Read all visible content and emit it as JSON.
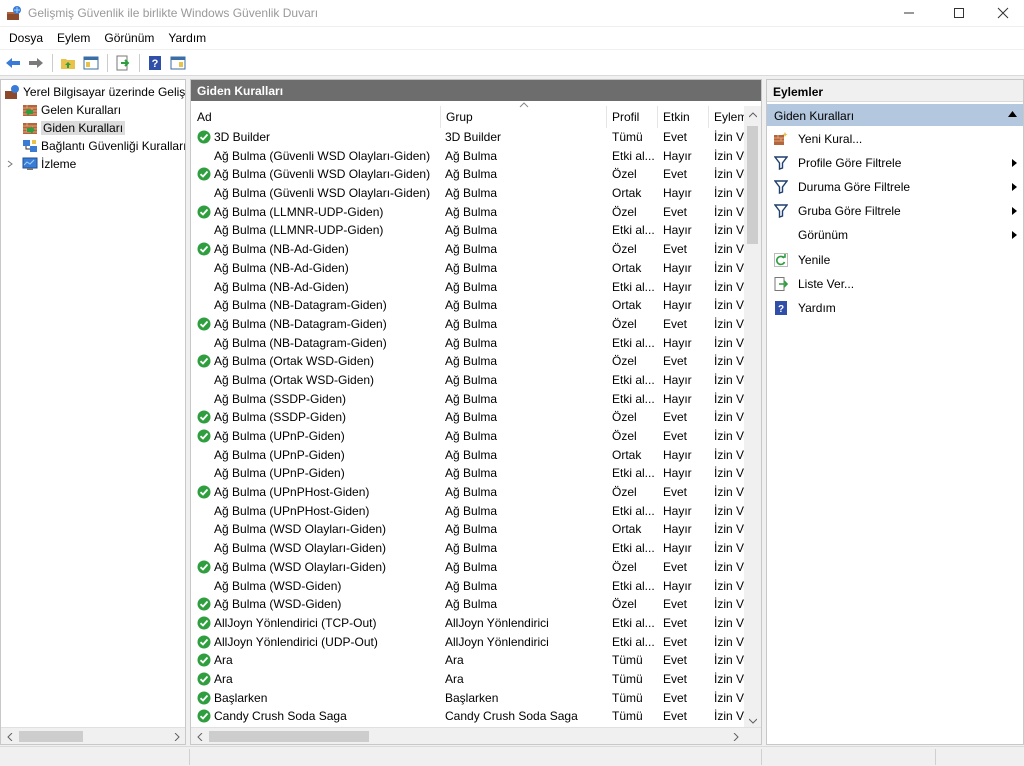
{
  "window": {
    "title": "Gelişmiş Güvenlik ile birlikte Windows Güvenlik Duvarı"
  },
  "menu": [
    "Dosya",
    "Eylem",
    "Görünüm",
    "Yardım"
  ],
  "tree": {
    "root": "Yerel Bilgisayar üzerinde Gelişm",
    "items": [
      "Gelen Kuralları",
      "Giden Kuralları",
      "Bağlantı Güvenliği Kuralları",
      "İzleme"
    ]
  },
  "center": {
    "header": "Giden Kuralları",
    "columns": [
      "Ad",
      "Grup",
      "Profil",
      "Etkin",
      "Eylem"
    ],
    "rows": [
      {
        "ad": "3D Builder",
        "grup": "3D Builder",
        "profil": "Tümü",
        "etkin": "Evet",
        "eylem": "İzin Ver",
        "on": true
      },
      {
        "ad": "Ağ Bulma (Güvenli WSD Olayları-Giden)",
        "grup": "Ağ Bulma",
        "profil": "Etki al...",
        "etkin": "Hayır",
        "eylem": "İzin Ver",
        "on": false
      },
      {
        "ad": "Ağ Bulma (Güvenli WSD Olayları-Giden)",
        "grup": "Ağ Bulma",
        "profil": "Özel",
        "etkin": "Evet",
        "eylem": "İzin Ver",
        "on": true
      },
      {
        "ad": "Ağ Bulma (Güvenli WSD Olayları-Giden)",
        "grup": "Ağ Bulma",
        "profil": "Ortak",
        "etkin": "Hayır",
        "eylem": "İzin Ver",
        "on": false
      },
      {
        "ad": "Ağ Bulma (LLMNR-UDP-Giden)",
        "grup": "Ağ Bulma",
        "profil": "Özel",
        "etkin": "Evet",
        "eylem": "İzin Ver",
        "on": true
      },
      {
        "ad": "Ağ Bulma (LLMNR-UDP-Giden)",
        "grup": "Ağ Bulma",
        "profil": "Etki al...",
        "etkin": "Hayır",
        "eylem": "İzin Ver",
        "on": false
      },
      {
        "ad": "Ağ Bulma (NB-Ad-Giden)",
        "grup": "Ağ Bulma",
        "profil": "Özel",
        "etkin": "Evet",
        "eylem": "İzin Ver",
        "on": true
      },
      {
        "ad": "Ağ Bulma (NB-Ad-Giden)",
        "grup": "Ağ Bulma",
        "profil": "Ortak",
        "etkin": "Hayır",
        "eylem": "İzin Ver",
        "on": false
      },
      {
        "ad": "Ağ Bulma (NB-Ad-Giden)",
        "grup": "Ağ Bulma",
        "profil": "Etki al...",
        "etkin": "Hayır",
        "eylem": "İzin Ver",
        "on": false
      },
      {
        "ad": "Ağ Bulma (NB-Datagram-Giden)",
        "grup": "Ağ Bulma",
        "profil": "Ortak",
        "etkin": "Hayır",
        "eylem": "İzin Ver",
        "on": false
      },
      {
        "ad": "Ağ Bulma (NB-Datagram-Giden)",
        "grup": "Ağ Bulma",
        "profil": "Özel",
        "etkin": "Evet",
        "eylem": "İzin Ver",
        "on": true
      },
      {
        "ad": "Ağ Bulma (NB-Datagram-Giden)",
        "grup": "Ağ Bulma",
        "profil": "Etki al...",
        "etkin": "Hayır",
        "eylem": "İzin Ver",
        "on": false
      },
      {
        "ad": "Ağ Bulma (Ortak WSD-Giden)",
        "grup": "Ağ Bulma",
        "profil": "Özel",
        "etkin": "Evet",
        "eylem": "İzin Ver",
        "on": true
      },
      {
        "ad": "Ağ Bulma (Ortak WSD-Giden)",
        "grup": "Ağ Bulma",
        "profil": "Etki al...",
        "etkin": "Hayır",
        "eylem": "İzin Ver",
        "on": false
      },
      {
        "ad": "Ağ Bulma (SSDP-Giden)",
        "grup": "Ağ Bulma",
        "profil": "Etki al...",
        "etkin": "Hayır",
        "eylem": "İzin Ver",
        "on": false
      },
      {
        "ad": "Ağ Bulma (SSDP-Giden)",
        "grup": "Ağ Bulma",
        "profil": "Özel",
        "etkin": "Evet",
        "eylem": "İzin Ver",
        "on": true
      },
      {
        "ad": "Ağ Bulma (UPnP-Giden)",
        "grup": "Ağ Bulma",
        "profil": "Özel",
        "etkin": "Evet",
        "eylem": "İzin Ver",
        "on": true
      },
      {
        "ad": "Ağ Bulma (UPnP-Giden)",
        "grup": "Ağ Bulma",
        "profil": "Ortak",
        "etkin": "Hayır",
        "eylem": "İzin Ver",
        "on": false
      },
      {
        "ad": "Ağ Bulma (UPnP-Giden)",
        "grup": "Ağ Bulma",
        "profil": "Etki al...",
        "etkin": "Hayır",
        "eylem": "İzin Ver",
        "on": false
      },
      {
        "ad": "Ağ Bulma (UPnPHost-Giden)",
        "grup": "Ağ Bulma",
        "profil": "Özel",
        "etkin": "Evet",
        "eylem": "İzin Ver",
        "on": true
      },
      {
        "ad": "Ağ Bulma (UPnPHost-Giden)",
        "grup": "Ağ Bulma",
        "profil": "Etki al...",
        "etkin": "Hayır",
        "eylem": "İzin Ver",
        "on": false
      },
      {
        "ad": "Ağ Bulma (WSD Olayları-Giden)",
        "grup": "Ağ Bulma",
        "profil": "Ortak",
        "etkin": "Hayır",
        "eylem": "İzin Ver",
        "on": false
      },
      {
        "ad": "Ağ Bulma (WSD Olayları-Giden)",
        "grup": "Ağ Bulma",
        "profil": "Etki al...",
        "etkin": "Hayır",
        "eylem": "İzin Ver",
        "on": false
      },
      {
        "ad": "Ağ Bulma (WSD Olayları-Giden)",
        "grup": "Ağ Bulma",
        "profil": "Özel",
        "etkin": "Evet",
        "eylem": "İzin Ver",
        "on": true
      },
      {
        "ad": "Ağ Bulma (WSD-Giden)",
        "grup": "Ağ Bulma",
        "profil": "Etki al...",
        "etkin": "Hayır",
        "eylem": "İzin Ver",
        "on": false
      },
      {
        "ad": "Ağ Bulma (WSD-Giden)",
        "grup": "Ağ Bulma",
        "profil": "Özel",
        "etkin": "Evet",
        "eylem": "İzin Ver",
        "on": true
      },
      {
        "ad": "AllJoyn Yönlendirici (TCP-Out)",
        "grup": "AllJoyn Yönlendirici",
        "profil": "Etki al...",
        "etkin": "Evet",
        "eylem": "İzin Ver",
        "on": true
      },
      {
        "ad": "AllJoyn Yönlendirici (UDP-Out)",
        "grup": "AllJoyn Yönlendirici",
        "profil": "Etki al...",
        "etkin": "Evet",
        "eylem": "İzin Ver",
        "on": true
      },
      {
        "ad": "Ara",
        "grup": "Ara",
        "profil": "Tümü",
        "etkin": "Evet",
        "eylem": "İzin Ver",
        "on": true
      },
      {
        "ad": "Ara",
        "grup": "Ara",
        "profil": "Tümü",
        "etkin": "Evet",
        "eylem": "İzin Ver",
        "on": true
      },
      {
        "ad": "Başlarken",
        "grup": "Başlarken",
        "profil": "Tümü",
        "etkin": "Evet",
        "eylem": "İzin Ver",
        "on": true
      },
      {
        "ad": "Candy Crush Soda Saga",
        "grup": "Candy Crush Soda Saga",
        "profil": "Tümü",
        "etkin": "Evet",
        "eylem": "İzin Ver",
        "on": true
      }
    ]
  },
  "actions": {
    "title": "Eylemler",
    "section": "Giden Kuralları",
    "items": [
      {
        "label": "Yeni Kural...",
        "icon": "new-rule-icon",
        "submenu": false
      },
      {
        "label": "Profile Göre Filtrele",
        "icon": "filter-icon",
        "submenu": true
      },
      {
        "label": "Duruma Göre Filtrele",
        "icon": "filter-icon",
        "submenu": true
      },
      {
        "label": "Gruba Göre Filtrele",
        "icon": "filter-icon",
        "submenu": true
      },
      {
        "label": "Görünüm",
        "icon": "",
        "submenu": true
      },
      {
        "label": "Yenile",
        "icon": "refresh-icon",
        "submenu": false
      },
      {
        "label": "Liste Ver...",
        "icon": "export-list-icon",
        "submenu": false
      },
      {
        "label": "Yardım",
        "icon": "help-icon",
        "submenu": false
      }
    ]
  },
  "colors": {
    "section_highlight": "#b3c7de",
    "panel_header": "#6d6d6d",
    "enabled_check": "#2e9e3e"
  }
}
